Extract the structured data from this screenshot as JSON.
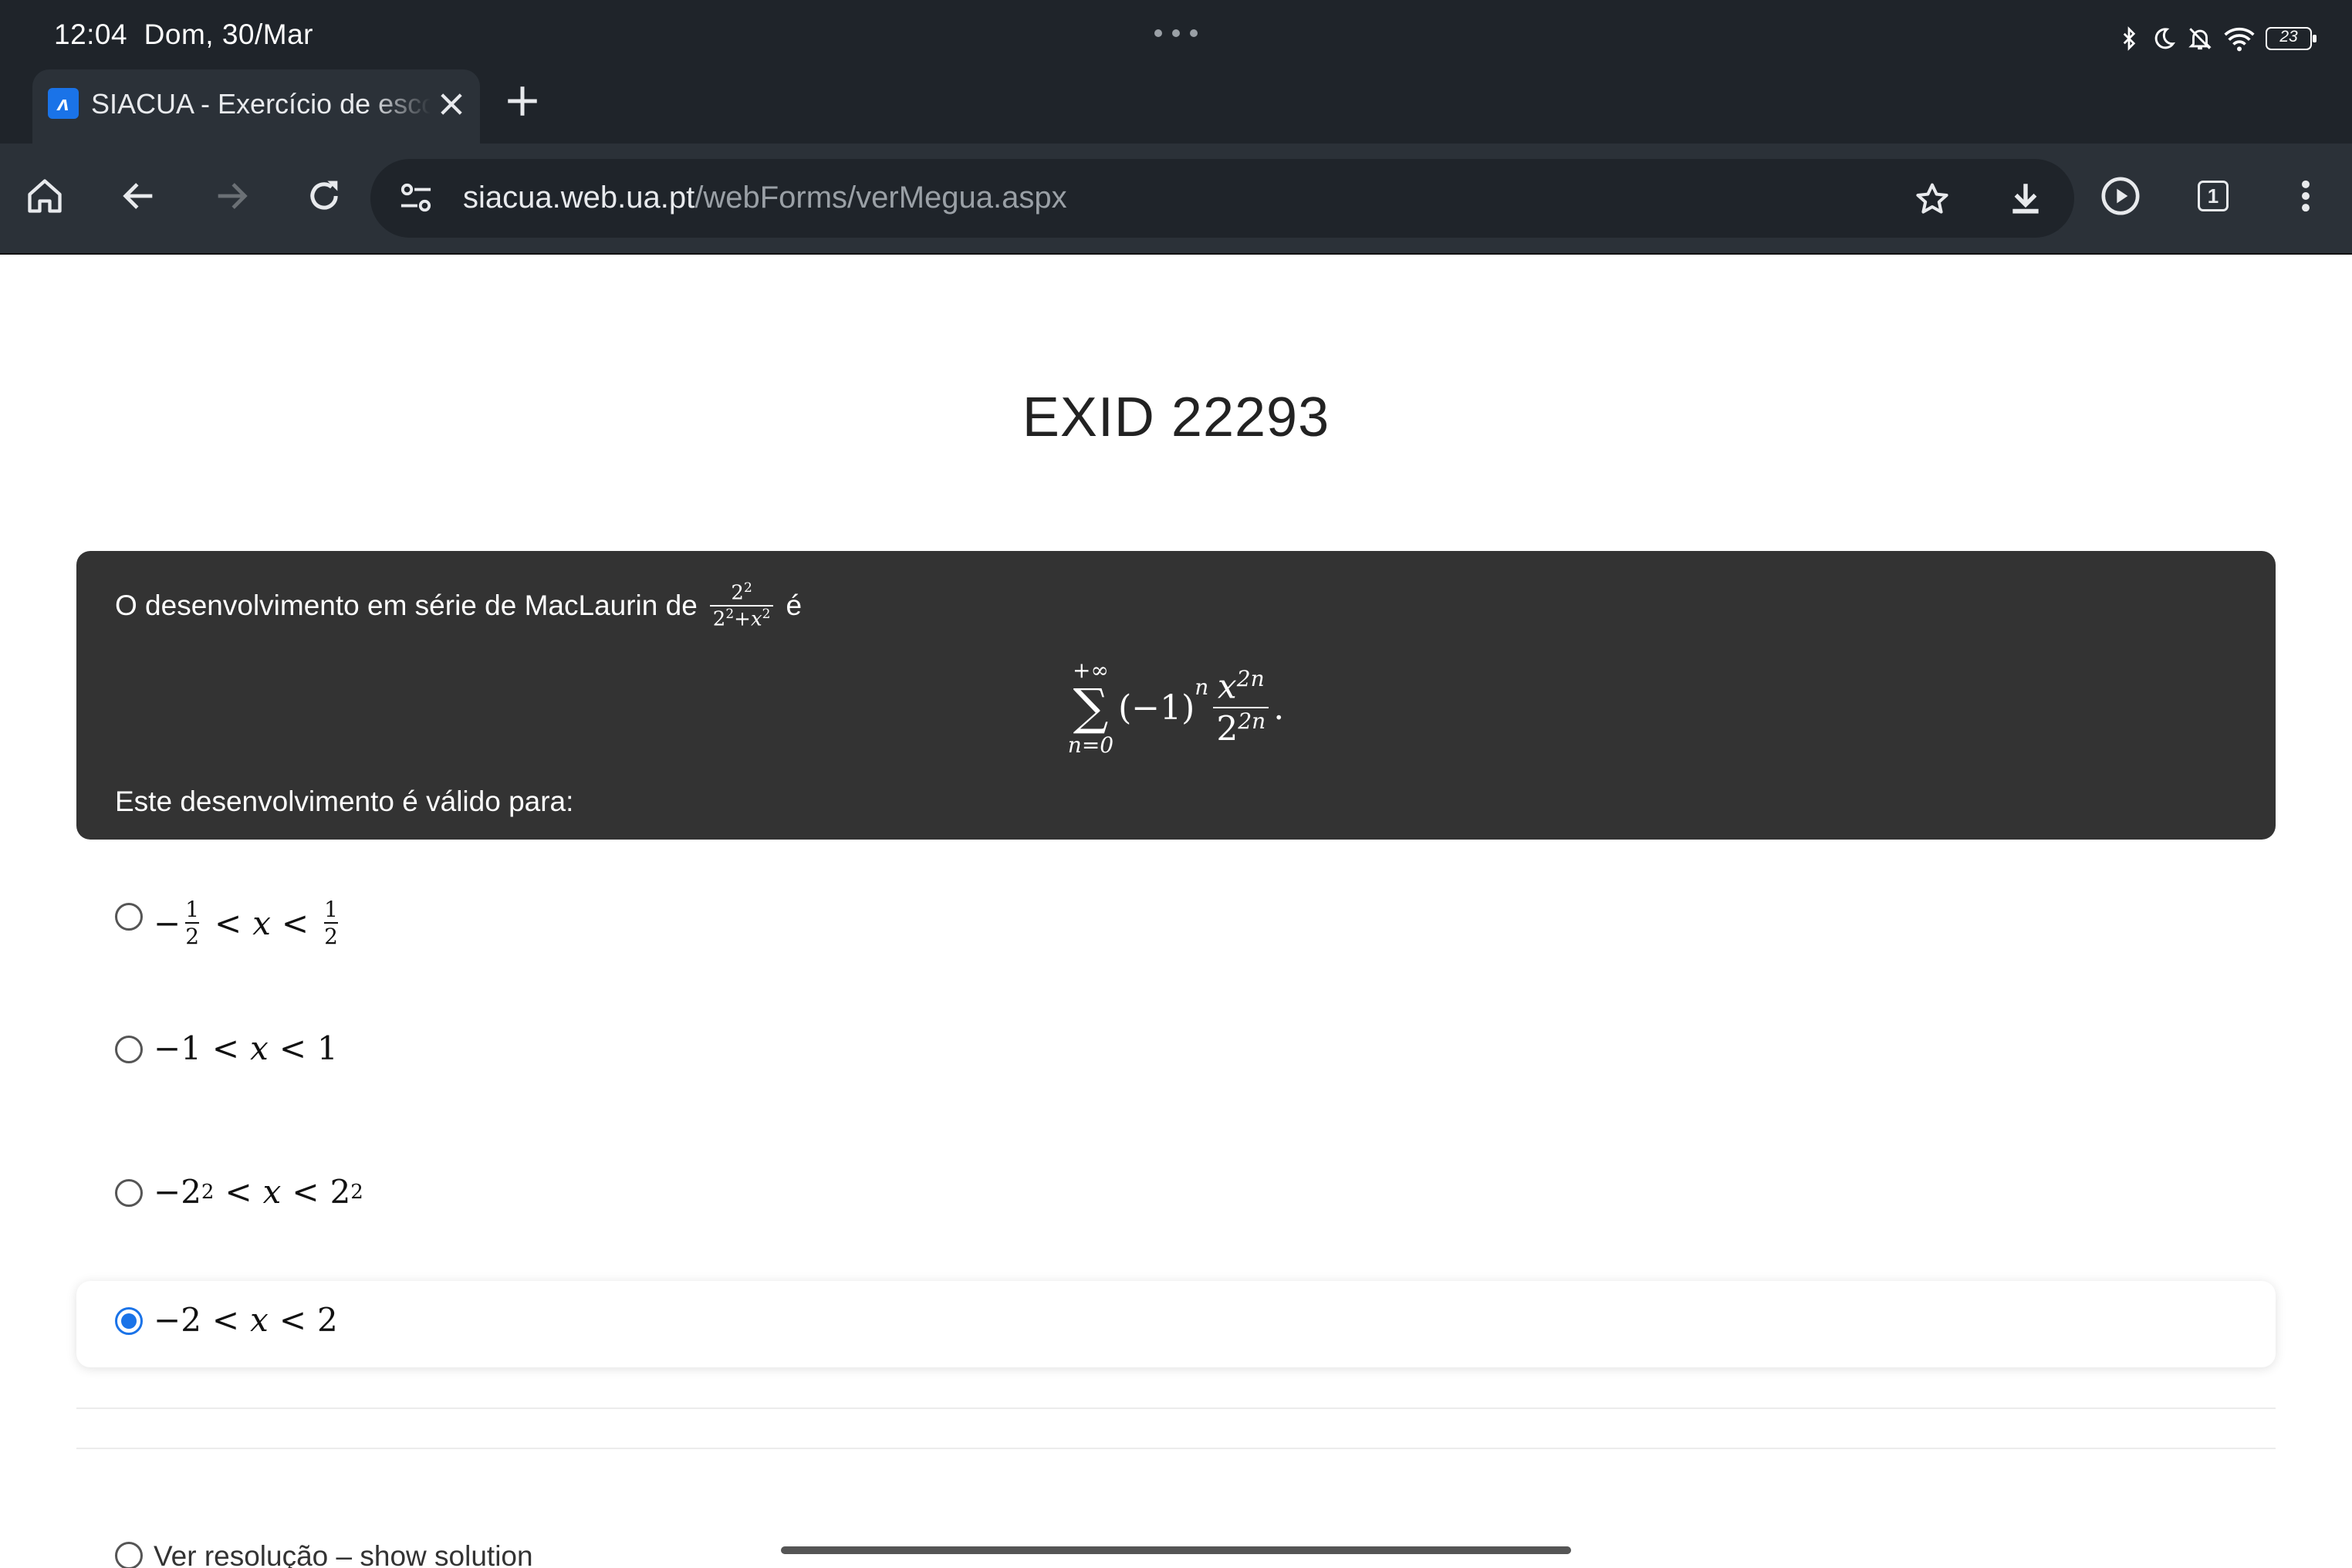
{
  "status_bar": {
    "time": "12:04",
    "date": "Dom, 30/Mar",
    "battery": "23"
  },
  "tab": {
    "title": "SIACUA - Exercício de escolha múltipla",
    "favicon_text": "ʌ"
  },
  "address_bar": {
    "host": "siacua.web.ua.pt",
    "path": "/webForms/verMegua.aspx",
    "tab_count": "1"
  },
  "page": {
    "heading": "EXID 22293",
    "question": {
      "intro": "O desenvolvimento em série de MacLaurin de",
      "intro_frac_num": "2",
      "intro_frac_num_exp": "2",
      "intro_frac_den_a": "2",
      "intro_frac_den_a_exp": "2",
      "intro_frac_den_plus": "+",
      "intro_frac_den_b": "x",
      "intro_frac_den_b_exp": "2",
      "intro_end": "é",
      "sum_upper": "+∞",
      "sum_symbol": "∑",
      "sum_lower": "n=0",
      "term_base": "(−1)",
      "term_exp": "n",
      "frac_num": "x",
      "frac_num_exp": "2n",
      "frac_den": "2",
      "frac_den_exp": "2n",
      "period": ".",
      "validity": "Este desenvolvimento é válido para:"
    },
    "options": [
      {
        "minus": "−",
        "lhs_num": "1",
        "lhs_den": "2",
        "op1": "<",
        "var": "x",
        "op2": "<",
        "rhs_num": "1",
        "rhs_den": "2",
        "selected": false
      },
      {
        "text_lhs": "−1",
        "op1": "<",
        "var": "x",
        "op2": "<",
        "text_rhs": "1",
        "selected": false
      },
      {
        "lhs": "−2",
        "lhs_exp": "2",
        "op1": "<",
        "var": "x",
        "op2": "<",
        "rhs": "2",
        "rhs_exp": "2",
        "selected": false
      },
      {
        "text_lhs": "−2",
        "op1": "<",
        "var": "x",
        "op2": "<",
        "text_rhs": "2",
        "selected": true
      }
    ],
    "show_solution_label": "Ver resolução – show solution"
  }
}
